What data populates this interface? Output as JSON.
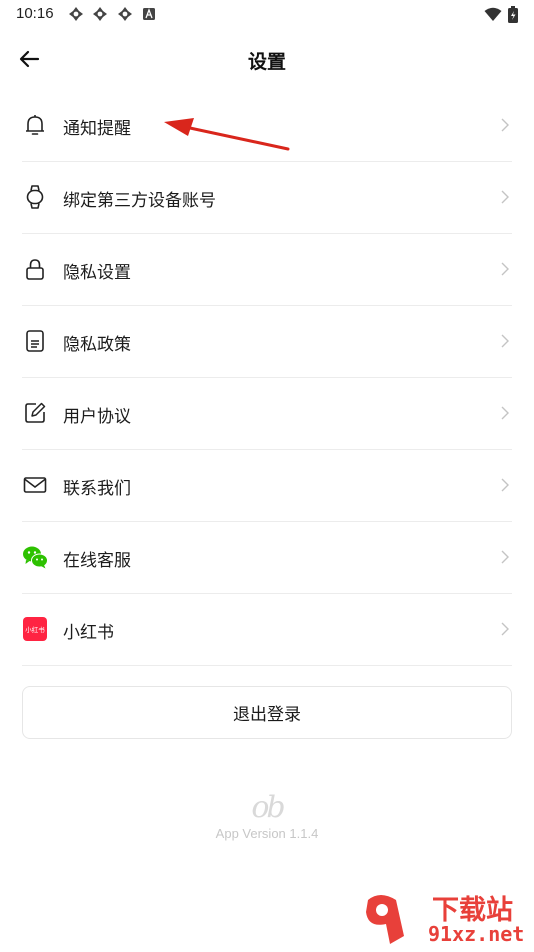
{
  "status_bar": {
    "time": "10:16",
    "notification_icons": [
      "app-icon",
      "app-icon",
      "app-icon",
      "a-icon"
    ],
    "right_icons": [
      "wifi-icon",
      "battery-icon"
    ]
  },
  "header": {
    "title": "设置",
    "back_icon": "arrow-left-icon"
  },
  "settings": {
    "items": [
      {
        "label": "通知提醒",
        "icon": "bell-icon"
      },
      {
        "label": "绑定第三方设备账号",
        "icon": "watch-icon"
      },
      {
        "label": "隐私设置",
        "icon": "lock-icon"
      },
      {
        "label": "隐私政策",
        "icon": "document-icon"
      },
      {
        "label": "用户协议",
        "icon": "edit-icon"
      },
      {
        "label": "联系我们",
        "icon": "mail-icon"
      },
      {
        "label": "在线客服",
        "icon": "wechat-icon"
      },
      {
        "label": "小红书",
        "icon": "xiaohongshu-icon",
        "icon_text": "小红书"
      }
    ]
  },
  "logout": {
    "label": "退出登录"
  },
  "footer": {
    "logo_text": "ob",
    "version": "App Version 1.1.4"
  },
  "watermark": {
    "line1": "下载站",
    "line2": "91xz.net"
  },
  "colors": {
    "annotation_arrow": "#d9261c",
    "wechat_green": "#2dc100",
    "xiaohongshu_red": "#ff2442",
    "divider": "#ececec"
  }
}
